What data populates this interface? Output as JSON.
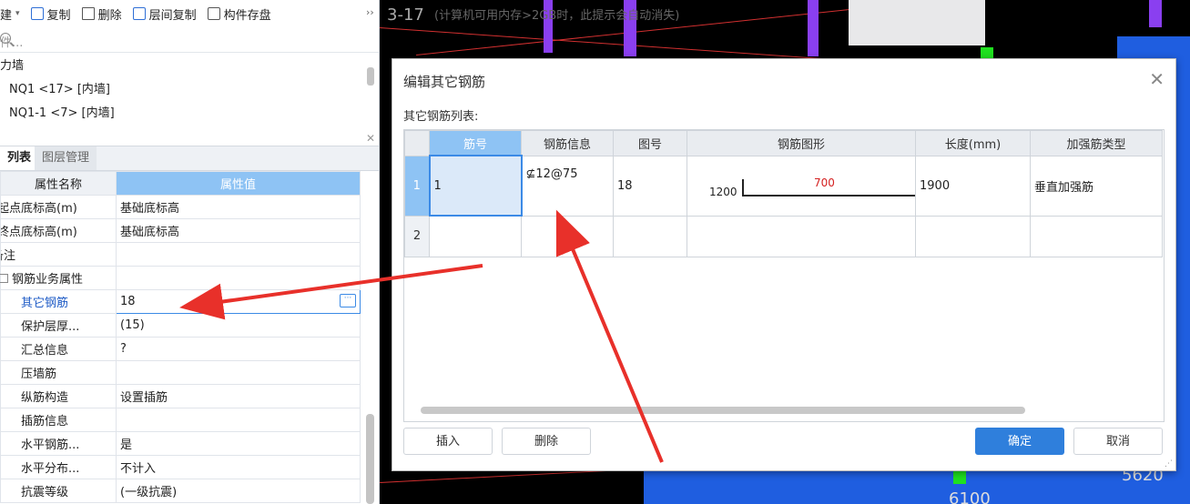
{
  "toolbar": {
    "items": [
      {
        "label": "建",
        "icon": "new-icon"
      },
      {
        "label": "复制",
        "icon": "copy-icon"
      },
      {
        "label": "删除",
        "icon": "trash-icon"
      },
      {
        "label": "层间复制",
        "icon": "layer-copy-icon"
      },
      {
        "label": "构件存盘",
        "icon": "save-component-icon"
      }
    ],
    "more": "››"
  },
  "search": {
    "placeholder": "件..."
  },
  "tree": {
    "group": "力墙",
    "items": [
      "NQ1 <17> [内墙]",
      "NQ1-1 <7> [内墙]"
    ]
  },
  "tabs": [
    "列表",
    "图层管理"
  ],
  "props": {
    "col_name": "属性名称",
    "col_value": "属性值",
    "rows": [
      {
        "name": "起点底标高(m)",
        "value": "基础底标高"
      },
      {
        "name": "终点底标高(m)",
        "value": "基础底标高"
      },
      {
        "name": "备注",
        "value": ""
      },
      {
        "name": "钢筋业务属性",
        "value": ""
      },
      {
        "name": "其它钢筋",
        "value": "18"
      },
      {
        "name": "保护层厚...",
        "value": "(15)"
      },
      {
        "name": "汇总信息",
        "value": "?"
      },
      {
        "name": "压墙筋",
        "value": ""
      },
      {
        "name": "纵筋构造",
        "value": "设置插筋"
      },
      {
        "name": "插筋信息",
        "value": ""
      },
      {
        "name": "水平钢筋...",
        "value": "是"
      },
      {
        "name": "水平分布...",
        "value": "不计入"
      },
      {
        "name": "抗震等级",
        "value": "(一级抗震)"
      }
    ]
  },
  "view": {
    "floor": "3-17",
    "note": "(计算机可用内存>2GB时，此提示会自动消失)",
    "dim1": "5620",
    "dim2": "6100"
  },
  "dialog": {
    "title": "编辑其它钢筋",
    "list_label": "其它钢筋列表:",
    "columns": [
      "筋号",
      "钢筋信息",
      "图号",
      "钢筋图形",
      "长度(mm)",
      "加强筋类型"
    ],
    "rows": [
      {
        "num": "1",
        "id": "1",
        "info": "⊈12@75",
        "fig": "18",
        "shape_left": "1200",
        "shape_top": "700",
        "length": "1900",
        "type": "垂直加强筋"
      },
      {
        "num": "2",
        "id": "",
        "info": "",
        "fig": "",
        "shape_left": "",
        "shape_top": "",
        "length": "",
        "type": ""
      }
    ],
    "buttons": {
      "insert": "插入",
      "delete": "删除",
      "ok": "确定",
      "cancel": "取消"
    }
  },
  "colors": {
    "accent": "#2f7fdc",
    "header_hl": "#8ec3f4",
    "arrow": "#e8302a"
  }
}
